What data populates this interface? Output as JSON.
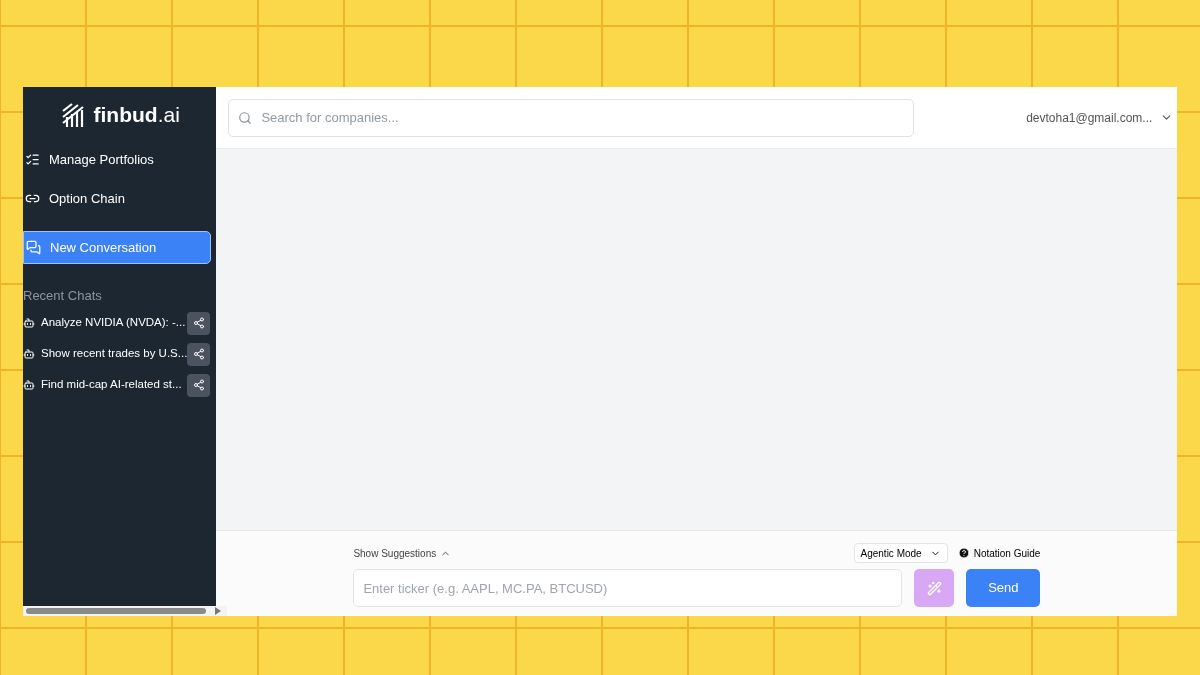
{
  "logo": {
    "name": "finbud",
    "suffix": ".ai"
  },
  "nav": [
    {
      "label": "Manage Portfolios",
      "kind": "list",
      "selected": false
    },
    {
      "label": "Option Chain",
      "kind": "link",
      "selected": false
    },
    {
      "label": "New Conversation",
      "kind": "chat",
      "selected": true
    }
  ],
  "recent_chats": {
    "title": "Recent Chats",
    "items": [
      "Analyze NVIDIA (NVDA): -...",
      "Show recent trades by U.S...",
      "Find mid-cap AI-related st..."
    ]
  },
  "search": {
    "placeholder": "Search for companies..."
  },
  "user": {
    "email": "devtoha1@gmail.com..."
  },
  "composer": {
    "suggestions_toggle": "Show Suggestions",
    "mode": "Agentic Mode",
    "guide": "Notation Guide",
    "placeholder": "Enter ticker (e.g. AAPL, MC.PA, BTCUSD)",
    "send": "Send"
  }
}
